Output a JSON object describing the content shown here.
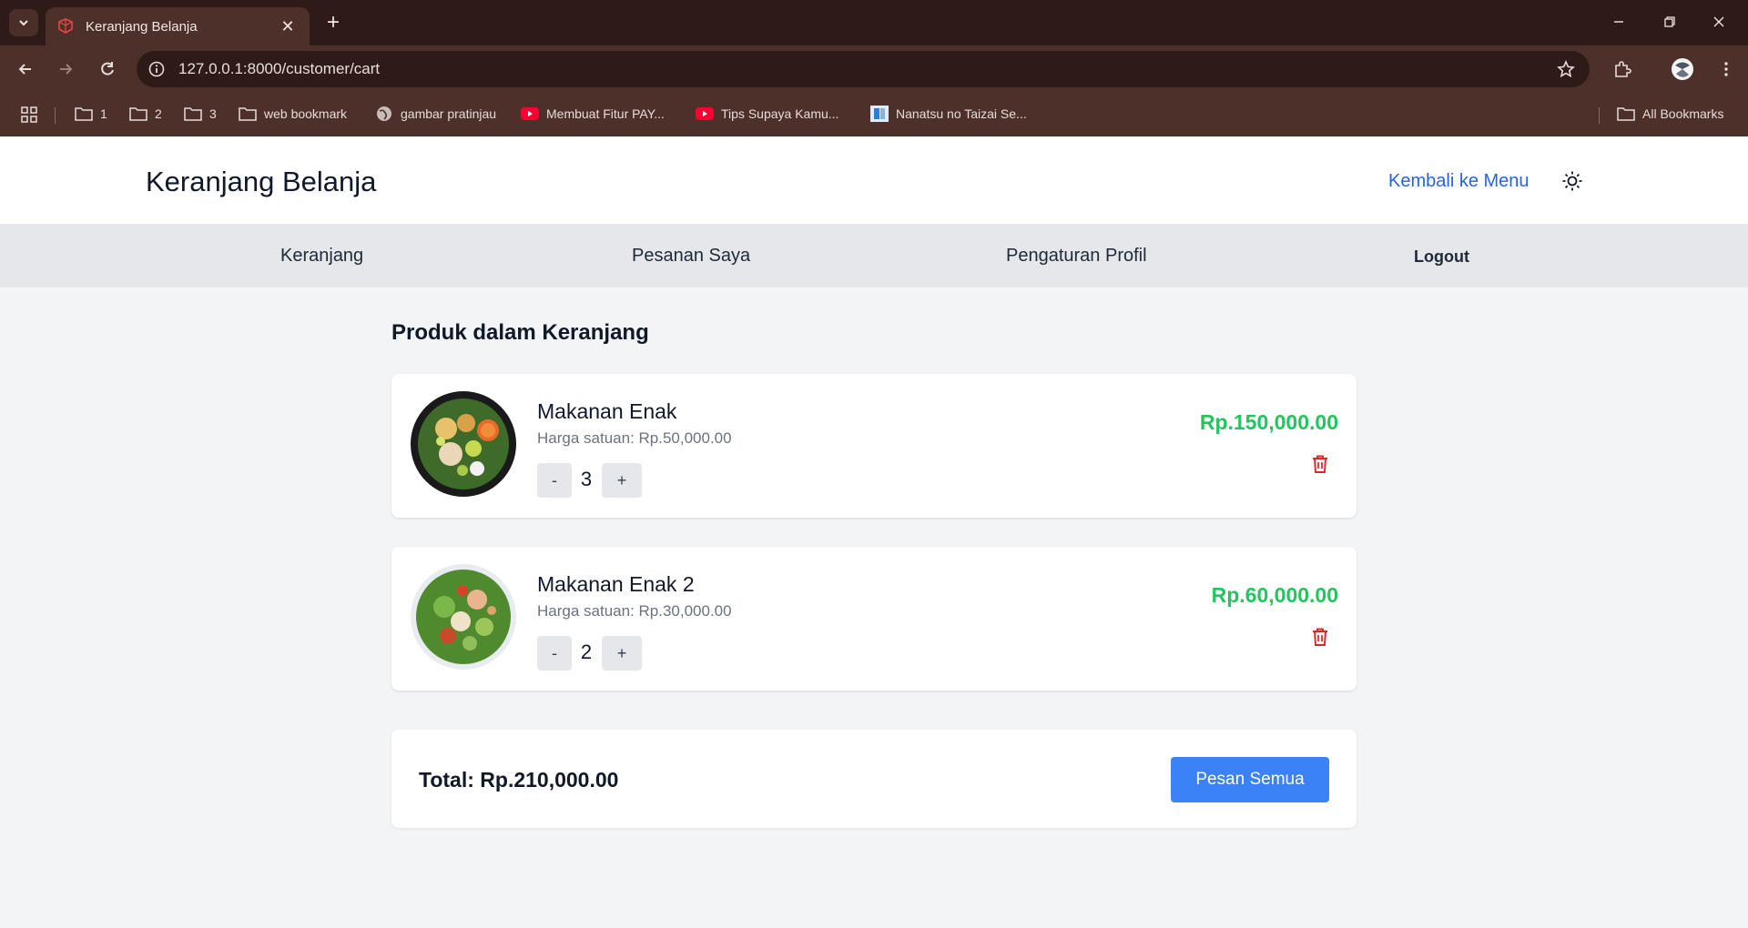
{
  "browser": {
    "tab_title": "Keranjang Belanja",
    "url": "127.0.0.1:8000/customer/cart",
    "bookmarks": [
      {
        "label": "1",
        "icon": "folder-icon"
      },
      {
        "label": "2",
        "icon": "folder-icon"
      },
      {
        "label": "3",
        "icon": "folder-icon"
      },
      {
        "label": "web bookmark",
        "icon": "folder-icon"
      },
      {
        "label": "gambar pratinjau",
        "icon": "globe-icon"
      },
      {
        "label": "Membuat Fitur PAY...",
        "icon": "youtube-icon"
      },
      {
        "label": "Tips Supaya Kamu...",
        "icon": "youtube-icon"
      },
      {
        "label": "Nanatsu no Taizai Se...",
        "icon": "site-icon"
      }
    ],
    "all_bookmarks": "All Bookmarks"
  },
  "header": {
    "title": "Keranjang Belanja",
    "back_link": "Kembali ke Menu"
  },
  "subnav": {
    "items": [
      "Keranjang",
      "Pesanan Saya",
      "Pengaturan Profil",
      "Logout"
    ]
  },
  "cart": {
    "section_title": "Produk dalam Keranjang",
    "items": [
      {
        "name": "Makanan Enak",
        "unit_price": "Harga satuan: Rp.50,000.00",
        "qty": "3",
        "minus": "-",
        "plus": "+",
        "subtotal": "Rp.150,000.00"
      },
      {
        "name": "Makanan Enak 2",
        "unit_price": "Harga satuan: Rp.30,000.00",
        "qty": "2",
        "minus": "-",
        "plus": "+",
        "subtotal": "Rp.60,000.00"
      }
    ],
    "total": "Total: Rp.210,000.00",
    "order_button": "Pesan Semua"
  },
  "colors": {
    "accent": "#3b82f6",
    "price_green": "#22c55e",
    "delete_red": "#dc2626",
    "link_blue": "#2563eb"
  }
}
